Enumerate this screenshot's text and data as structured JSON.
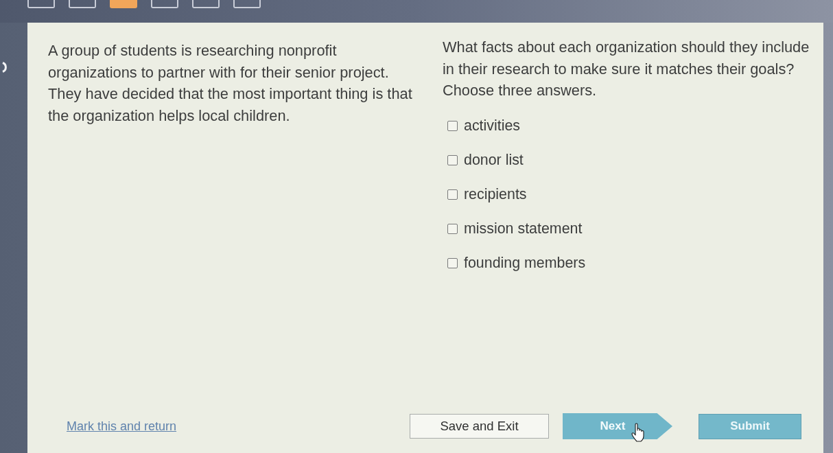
{
  "question_nav": [
    {
      "selected": false
    },
    {
      "selected": false
    },
    {
      "selected": true
    },
    {
      "selected": false
    },
    {
      "selected": false
    },
    {
      "selected": false
    }
  ],
  "passage": "A group of students is researching nonprofit organizations to partner with for their senior project. They have decided that the most important thing is that the organization helps local children.",
  "question": {
    "prompt": "What facts about each organization should they include in their research to make sure it matches their goals?",
    "instruction": "Choose three answers.",
    "choices": [
      {
        "label": "activities",
        "checked": false
      },
      {
        "label": "donor list",
        "checked": false
      },
      {
        "label": "recipients",
        "checked": false
      },
      {
        "label": "mission statement",
        "checked": false
      },
      {
        "label": "founding members",
        "checked": false
      }
    ]
  },
  "footer": {
    "mark_link": "Mark this and return",
    "save_button": "Save and Exit",
    "next_button": "Next",
    "submit_button": "Submit"
  }
}
